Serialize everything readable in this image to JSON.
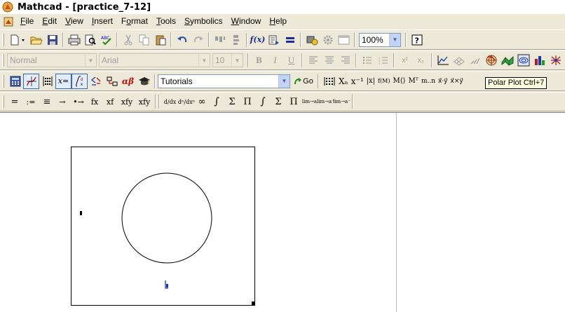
{
  "window": {
    "title": "Mathcad - [practice_7-12]"
  },
  "menus": [
    {
      "label": "File",
      "u": "F",
      "rest": "ile"
    },
    {
      "label": "Edit",
      "u": "E",
      "rest": "dit"
    },
    {
      "label": "View",
      "u": "V",
      "rest": "iew"
    },
    {
      "label": "Insert",
      "u": "I",
      "rest": "nsert"
    },
    {
      "label": "Format",
      "pre": "F",
      "u": "o",
      "rest": "rmat"
    },
    {
      "label": "Tools",
      "u": "T",
      "rest": "ools"
    },
    {
      "label": "Symbolics",
      "u": "S",
      "rest": "ymbolics"
    },
    {
      "label": "Window",
      "u": "W",
      "rest": "indow"
    },
    {
      "label": "Help",
      "u": "H",
      "rest": "elp"
    }
  ],
  "standard_toolbar": {
    "zoom": "100%"
  },
  "formatting_toolbar": {
    "style": "Normal",
    "font": "Arial",
    "size": "10",
    "bold": "B",
    "italic": "I",
    "underline": "U",
    "superscript": "x²",
    "subscript": "x₂"
  },
  "math_toolbar": {
    "resources": "Tutorials",
    "go_label": "Go",
    "matrix_items": [
      "Xₙ",
      "x⁻¹",
      "|x|",
      "f(M)",
      "M⟨⟩",
      "Mᵀ",
      "m..n",
      "x⃗·y⃗",
      "x⃗×y⃗"
    ]
  },
  "tooltip": "Polar Plot Ctrl+7",
  "evaluation_toolbar": {
    "items": [
      "=",
      ":=",
      "≡",
      "→",
      "•→",
      "fx",
      "xf",
      "xfy",
      "xfy"
    ]
  },
  "calculus_toolbar": {
    "items": [
      "d/dx",
      "dⁿ/dxⁿ",
      "∞",
      "∫",
      "Σ",
      "Π",
      "∫",
      "Σ",
      "Π",
      "lim→a",
      "lim→a⁺",
      "lim→a⁻"
    ]
  }
}
